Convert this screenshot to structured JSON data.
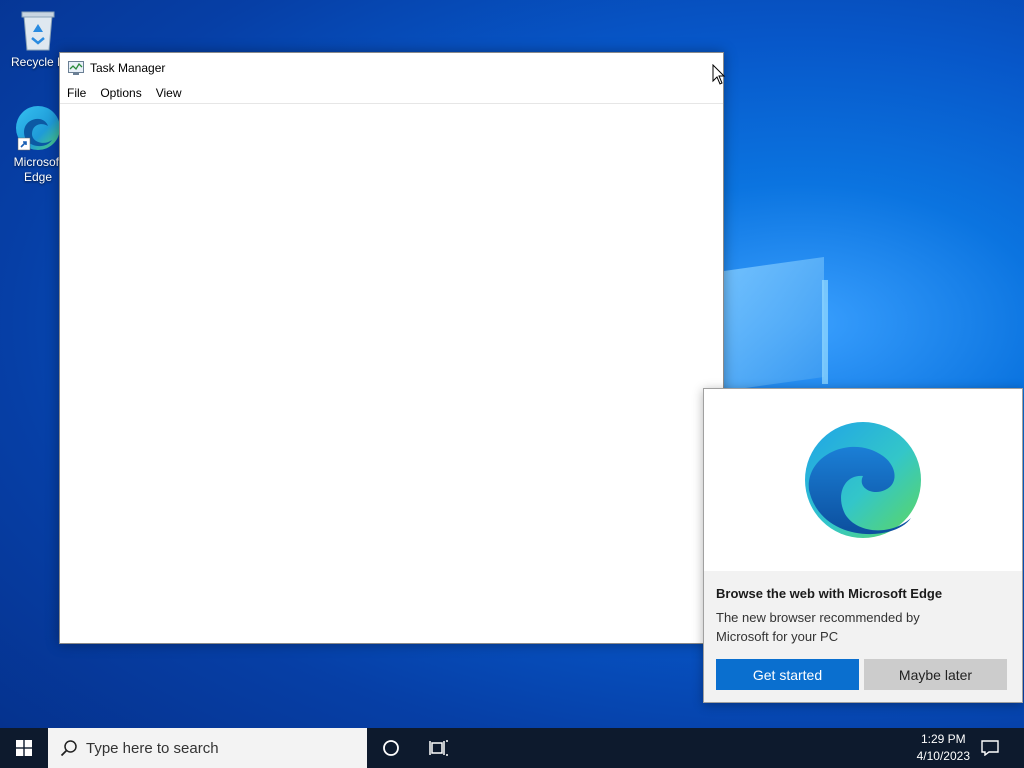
{
  "desktop": {
    "icons": [
      {
        "label": "Recycle B",
        "icon": "recycle-bin-icon"
      },
      {
        "label": "Microsoft Edge",
        "icon": "edge-icon"
      }
    ]
  },
  "task_manager": {
    "title": "Task Manager",
    "menu": [
      "File",
      "Options",
      "View"
    ]
  },
  "edge_promo": {
    "title": "Browse the web with Microsoft Edge",
    "body": "The new browser recommended by Microsoft for your PC",
    "primary_button": "Get started",
    "secondary_button": "Maybe later"
  },
  "taskbar": {
    "search_placeholder": "Type here to search",
    "time": "1:29 PM",
    "date": "4/10/2023"
  },
  "colors": {
    "accent": "#0a6fcf",
    "taskbar": "#0d1a2d"
  }
}
